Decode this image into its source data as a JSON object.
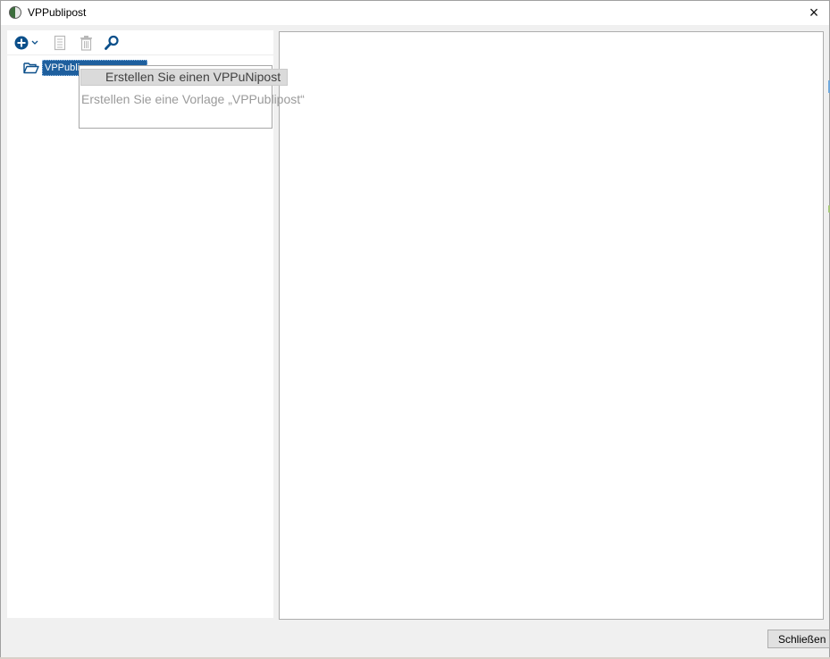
{
  "window": {
    "title": "VPPublipost",
    "close_glyph": "×"
  },
  "toolbar": {
    "icons": [
      "plus-circle-icon",
      "chevron-down-icon",
      "document-icon",
      "trash-icon",
      "search-icon"
    ]
  },
  "tree": {
    "items": [
      {
        "label": "VPPubli",
        "icon": "folder-open-icon",
        "selected": true
      }
    ]
  },
  "context_menu": {
    "items": [
      {
        "label": "Erstellen Sie einen VPPuNipost",
        "highlighted": true
      },
      {
        "label": "Erstellen Sie eine Vorlage „VPPublipost“",
        "enabled": false
      }
    ]
  },
  "footer": {
    "close_label": "Schließen"
  },
  "colors": {
    "accent": "#1e5f9e",
    "icon_blue": "#0b4f8a",
    "disabled_icon": "#b8b8b8"
  }
}
